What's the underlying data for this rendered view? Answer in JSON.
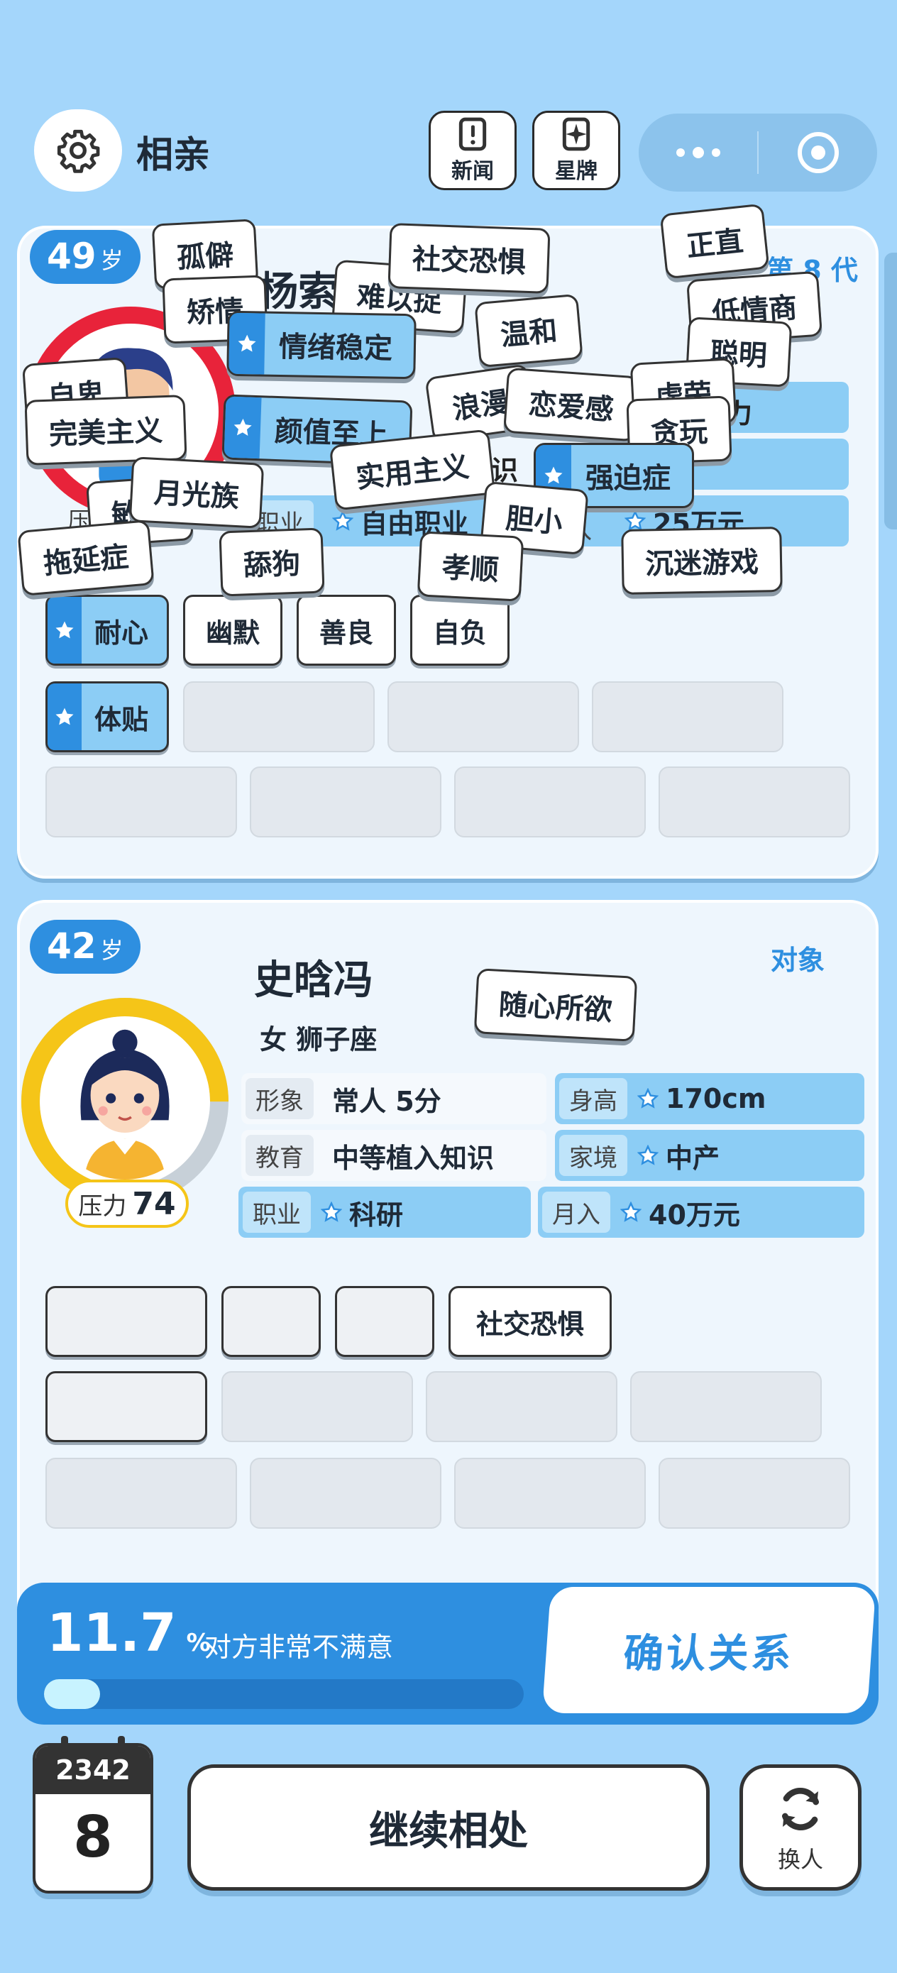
{
  "header": {
    "title": "相亲",
    "news_label": "新闻",
    "stars_label": "星牌"
  },
  "colors": {
    "background": "#a4d6fb",
    "accent": "#2e8fe0",
    "card": "#eef6fd",
    "tag_blue": "#8ccdf5",
    "stress_ring": "#f5c518"
  },
  "player": {
    "age": "49",
    "age_unit": "岁",
    "name_partial": "杨索",
    "generation_label": "第 8 代",
    "partial_texts": {
      "stress_prefix": "压",
      "job_key": "职业",
      "job_value": "自由职业",
      "income_key": "入",
      "income_value": "25万元",
      "misc_a": "识",
      "misc_b": "高",
      "misc_c": "力"
    },
    "traits_row1": [
      "耐心",
      "幽默",
      "善良",
      "自负"
    ],
    "traits_row2": [
      "体贴"
    ],
    "floating_traits": [
      "孤僻",
      "矫情",
      "社交恐惧",
      "正直",
      "低情商",
      "难以捉",
      "情绪稳定",
      "温和",
      "聪明",
      "自卑",
      "完美主义",
      "颜值至上",
      "浪漫",
      "恋爱感",
      "贪玩",
      "虚荣",
      "实用主义",
      "强迫症",
      "敏感",
      "月光族",
      "胆小",
      "拖延症",
      "舔狗",
      "孝顺",
      "沉迷游戏"
    ]
  },
  "partner": {
    "age": "42",
    "age_unit": "岁",
    "name": "史晗冯",
    "gender_sign": "女 狮子座",
    "relation_label": "对象",
    "floating_trait": "随心所欲",
    "stress_label": "压力",
    "stress_value": "74",
    "stress_fraction": 0.74,
    "info": {
      "appearance_key": "形象",
      "appearance_value": "常人 5分",
      "height_key": "身高",
      "height_value": "170cm",
      "education_key": "教育",
      "education_value": "中等植入知识",
      "family_key": "家境",
      "family_value": "中产",
      "job_key": "职业",
      "job_value": "科研",
      "income_key": "月入",
      "income_value": "40万元"
    },
    "revealed_trait": "社交恐惧"
  },
  "satisfaction": {
    "percent": "11.7",
    "unit": "%",
    "fraction": 0.117,
    "message": "对方非常不满意",
    "confirm_label": "确认关系"
  },
  "bottom": {
    "year": "2342",
    "day": "8",
    "continue_label": "继续相处",
    "swap_label": "换人"
  }
}
